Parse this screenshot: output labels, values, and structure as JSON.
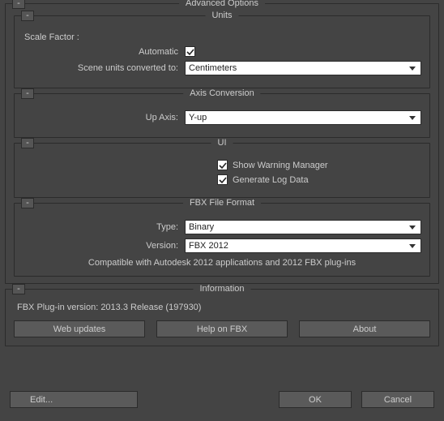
{
  "advanced": {
    "title": "Advanced Options",
    "units": {
      "title": "Units",
      "scale_factor_label": "Scale Factor :",
      "automatic_label": "Automatic",
      "automatic_checked": true,
      "scene_units_label": "Scene units converted to:",
      "scene_units_value": "Centimeters"
    },
    "axis": {
      "title": "Axis Conversion",
      "up_axis_label": "Up Axis:",
      "up_axis_value": "Y-up"
    },
    "ui": {
      "title": "UI",
      "warning_label": "Show Warning Manager",
      "warning_checked": true,
      "log_label": "Generate Log Data",
      "log_checked": true
    },
    "fbx": {
      "title": "FBX File Format",
      "type_label": "Type:",
      "type_value": "Binary",
      "version_label": "Version:",
      "version_value": "FBX 2012",
      "note": "Compatible with Autodesk 2012 applications and 2012 FBX plug-ins"
    }
  },
  "info": {
    "title": "Information",
    "plugin_version": "FBX Plug-in version: 2013.3 Release (197930)",
    "web_updates": "Web updates",
    "help": "Help on FBX",
    "about": "About"
  },
  "bottom": {
    "edit": "Edit...",
    "ok": "OK",
    "cancel": "Cancel"
  },
  "collapse_glyph": "-"
}
